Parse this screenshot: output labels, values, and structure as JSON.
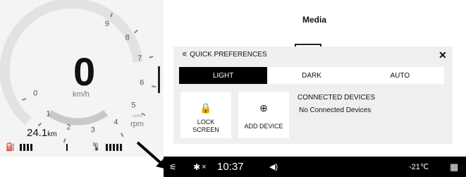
{
  "cluster": {
    "speed": "0",
    "speed_unit": "km/h",
    "rpm_unit": "rpm",
    "rpm_multiplier": "x1000",
    "odometer_value": "24.1",
    "odometer_unit": "km",
    "tach_labels": [
      "0",
      "1",
      "2",
      "3",
      "4",
      "5",
      "6",
      "7",
      "8",
      "9"
    ],
    "fuel_level_bars": 4,
    "temp_level_bars": 5
  },
  "media": {
    "title": "Media"
  },
  "quick_prefs": {
    "title": "QUICK PREFERENCES",
    "theme_options": [
      {
        "label": "LIGHT",
        "active": true
      },
      {
        "label": "DARK",
        "active": false
      },
      {
        "label": "AUTO",
        "active": false
      }
    ],
    "lock_screen_label": "LOCK SCREEN",
    "lock_screen_line1": "LOCK",
    "lock_screen_line2": "SCREEN",
    "add_device_label": "ADD DEVICE",
    "connected_devices_header": "CONNECTED DEVICES",
    "connected_devices_empty": "No Connected Devices"
  },
  "status_bar": {
    "bluetooth_text": "×",
    "time": "10:37",
    "outside_temp": "-21℃"
  },
  "icons": {
    "fuel": "fuel-pump-icon",
    "coolant": "coolant-temp-icon",
    "quick_prefs": "sliders-icon",
    "lock": "lock-icon",
    "add": "plus-circle-icon",
    "bluetooth": "bluetooth-icon",
    "volume": "speaker-icon",
    "apps": "grid-icon"
  }
}
